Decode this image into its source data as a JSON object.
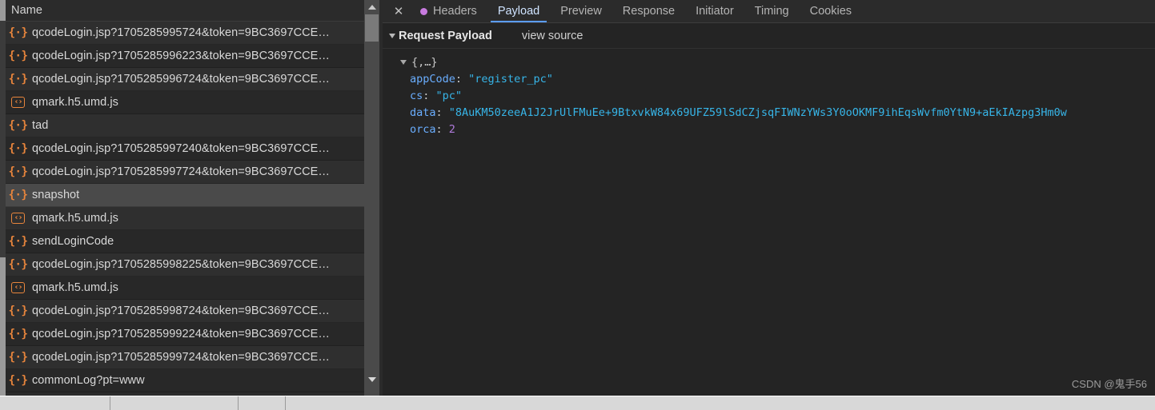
{
  "window": {
    "watermark": "CSDN @鬼手56"
  },
  "network_list": {
    "column_header": "Name",
    "rows": [
      {
        "icon": "xhr-icon",
        "name": "qcodeLogin.jsp?1705285995724&token=9BC3697CCE…",
        "state": "odd"
      },
      {
        "icon": "xhr-icon",
        "name": "qcodeLogin.jsp?1705285996223&token=9BC3697CCE…",
        "state": "even"
      },
      {
        "icon": "xhr-icon",
        "name": "qcodeLogin.jsp?1705285996724&token=9BC3697CCE…",
        "state": "odd"
      },
      {
        "icon": "script-icon",
        "name": "qmark.h5.umd.js",
        "state": "even"
      },
      {
        "icon": "xhr-icon",
        "name": "tad",
        "state": "odd"
      },
      {
        "icon": "xhr-icon",
        "name": "qcodeLogin.jsp?1705285997240&token=9BC3697CCE…",
        "state": "even"
      },
      {
        "icon": "xhr-icon",
        "name": "qcodeLogin.jsp?1705285997724&token=9BC3697CCE…",
        "state": "odd"
      },
      {
        "icon": "xhr-icon",
        "name": "snapshot",
        "state": "hover"
      },
      {
        "icon": "script-icon",
        "name": "qmark.h5.umd.js",
        "state": "odd"
      },
      {
        "icon": "xhr-icon",
        "name": "sendLoginCode",
        "state": "even"
      },
      {
        "icon": "xhr-icon",
        "name": "qcodeLogin.jsp?1705285998225&token=9BC3697CCE…",
        "state": "odd"
      },
      {
        "icon": "script-icon",
        "name": "qmark.h5.umd.js",
        "state": "even"
      },
      {
        "icon": "xhr-icon",
        "name": "qcodeLogin.jsp?1705285998724&token=9BC3697CCE…",
        "state": "odd"
      },
      {
        "icon": "xhr-icon",
        "name": "qcodeLogin.jsp?1705285999224&token=9BC3697CCE…",
        "state": "even"
      },
      {
        "icon": "xhr-icon",
        "name": "qcodeLogin.jsp?1705285999724&token=9BC3697CCE…",
        "state": "odd"
      },
      {
        "icon": "xhr-icon",
        "name": "commonLog?pt=www",
        "state": "even"
      }
    ]
  },
  "detail": {
    "close_label": "✕",
    "tabs": [
      {
        "label": "Headers",
        "active": false,
        "dot": true,
        "dot_color": "#c87bdf"
      },
      {
        "label": "Payload",
        "active": true,
        "dot": false
      },
      {
        "label": "Preview",
        "active": false,
        "dot": false
      },
      {
        "label": "Response",
        "active": false,
        "dot": false
      },
      {
        "label": "Initiator",
        "active": false,
        "dot": false
      },
      {
        "label": "Timing",
        "active": false,
        "dot": false
      },
      {
        "label": "Cookies",
        "active": false,
        "dot": false
      }
    ],
    "section_title": "Request Payload",
    "view_source_label": "view source",
    "object_preview": "{,…}",
    "properties": [
      {
        "key": "appCode",
        "value": "\"register_pc\"",
        "type": "string"
      },
      {
        "key": "cs",
        "value": "\"pc\"",
        "type": "string"
      },
      {
        "key": "data",
        "value": "\"8AuKM50zeeA1J2JrUlFMuEe+9BtxvkW84x69UFZ59lSdCZjsqFIWNzYWs3Y0oOKMF9ihEqsWvfm0YtN9+aEkIAzpg3Hm0w",
        "type": "string"
      },
      {
        "key": "orca",
        "value": "2",
        "type": "number"
      }
    ]
  },
  "colors": {
    "accent_tab_underline": "#5b9dff",
    "icon_orange": "#e8853c",
    "json_key": "#6aaeff",
    "json_string": "#37b5e8",
    "json_number": "#b07bdc",
    "headers_dot": "#c87bdf"
  }
}
